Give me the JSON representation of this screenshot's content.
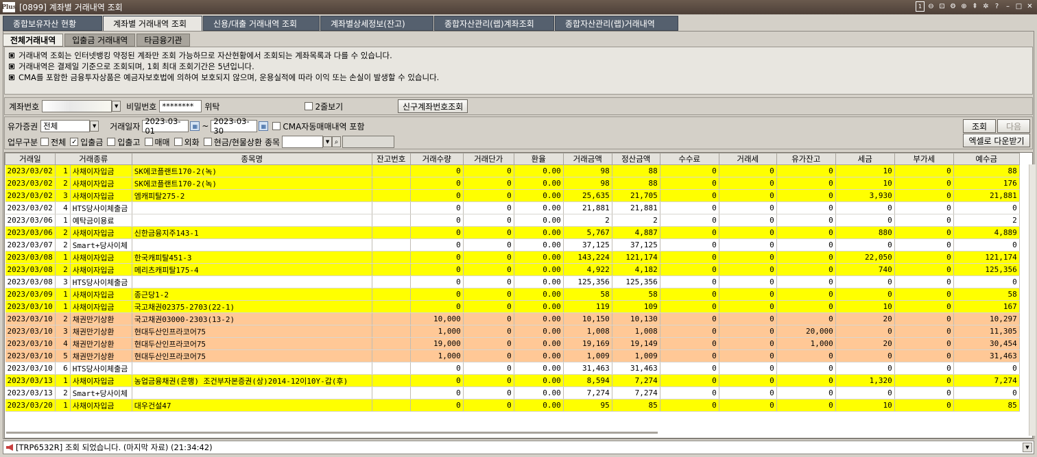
{
  "window": {
    "title": "[0899] 계좌별 거래내역 조회",
    "logo": "Plus",
    "page_indicator": "1"
  },
  "main_tabs": [
    {
      "label": "종합보유자산 현황",
      "active": false
    },
    {
      "label": "계좌별 거래내역 조회",
      "active": true
    },
    {
      "label": "신용/대출 거래내역 조회",
      "active": false
    },
    {
      "label": "계좌별상세정보(잔고)",
      "active": false
    },
    {
      "label": "종합자산관리(랩)계좌조회",
      "active": false
    },
    {
      "label": "종합자산관리(랩)거래내역",
      "active": false
    }
  ],
  "sub_tabs": [
    {
      "label": "전체거래내역",
      "active": true
    },
    {
      "label": "입출금 거래내역",
      "active": false
    },
    {
      "label": "타금융기관",
      "active": false
    }
  ],
  "notices": [
    "거래내역 조회는 인터넷뱅킹 약정된 계좌만 조회 가능하므로 자산현황에서 조회되는 계좌목록과 다를 수 있습니다.",
    "거래내역은 결제일 기준으로 조회되며, 1회 최대 조회기간은 5년입니다.",
    "CMA를 포함한 금융투자상품은 예금자보호법에 의하여 보호되지 않으며, 운용실적에 따라 이익 또는 손실이 발생할 수 있습니다."
  ],
  "account": {
    "label": "계좌번호",
    "password_label": "비밀번호",
    "password_value": "********",
    "trust_label": "위탁",
    "two_line_label": "2줄보기",
    "old_new_button": "신구계좌번호조회"
  },
  "filter": {
    "securities_label": "유가증권",
    "securities_value": "전체",
    "date_label": "거래일자",
    "date_from": "2023-03-01",
    "date_sep": "~",
    "date_to": "2023-03-30",
    "cma_label": "CMA자동매매내역 포함",
    "biz_label": "업무구분",
    "checks": [
      {
        "label": "전체",
        "checked": false
      },
      {
        "label": "입출금",
        "checked": true
      },
      {
        "label": "입출고",
        "checked": false
      },
      {
        "label": "매매",
        "checked": false
      },
      {
        "label": "외화",
        "checked": false
      },
      {
        "label": "현금/현물상환",
        "checked": false
      }
    ],
    "item_label": "종목",
    "query_button": "조회",
    "next_button": "다음",
    "excel_button": "엑셀로 다운받기"
  },
  "table": {
    "columns": [
      "거래일",
      "거래종류",
      "종목명",
      "잔고번호",
      "거래수량",
      "거래단가",
      "환율",
      "거래금액",
      "정산금액",
      "수수료",
      "거래세",
      "유가잔고",
      "세금",
      "부가세",
      "예수금"
    ],
    "rows": [
      {
        "style": "yellow",
        "cells": [
          "2023/03/02",
          "1",
          "사채이자입금",
          "SK에코플랜트170-2(녹)",
          "",
          "0",
          "0",
          "0.00",
          "98",
          "88",
          "0",
          "0",
          "0",
          "10",
          "0",
          "88"
        ]
      },
      {
        "style": "yellow",
        "cells": [
          "2023/03/02",
          "2",
          "사채이자입금",
          "SK에코플랜트170-2(녹)",
          "",
          "0",
          "0",
          "0.00",
          "98",
          "88",
          "0",
          "0",
          "0",
          "10",
          "0",
          "176"
        ]
      },
      {
        "style": "yellow",
        "cells": [
          "2023/03/02",
          "3",
          "사채이자입금",
          "엠캐피탈275-2",
          "",
          "0",
          "0",
          "0.00",
          "25,635",
          "21,705",
          "0",
          "0",
          "0",
          "3,930",
          "0",
          "21,881"
        ]
      },
      {
        "style": "white",
        "cells": [
          "2023/03/02",
          "4",
          "HTS당사이체출금",
          "",
          "",
          "0",
          "0",
          "0.00",
          "21,881",
          "21,881",
          "0",
          "0",
          "0",
          "0",
          "0",
          "0"
        ]
      },
      {
        "style": "white",
        "cells": [
          "2023/03/06",
          "1",
          "예탁금이용료",
          "",
          "",
          "0",
          "0",
          "0.00",
          "2",
          "2",
          "0",
          "0",
          "0",
          "0",
          "0",
          "2"
        ]
      },
      {
        "style": "yellow",
        "cells": [
          "2023/03/06",
          "2",
          "사채이자입금",
          "신한금융지주143-1",
          "",
          "0",
          "0",
          "0.00",
          "5,767",
          "4,887",
          "0",
          "0",
          "0",
          "880",
          "0",
          "4,889"
        ]
      },
      {
        "style": "white",
        "cells": [
          "2023/03/07",
          "2",
          "Smart+당사이체",
          "",
          "",
          "0",
          "0",
          "0.00",
          "37,125",
          "37,125",
          "0",
          "0",
          "0",
          "0",
          "0",
          "0"
        ]
      },
      {
        "style": "yellow",
        "cells": [
          "2023/03/08",
          "1",
          "사채이자입금",
          "한국캐피탈451-3",
          "",
          "0",
          "0",
          "0.00",
          "143,224",
          "121,174",
          "0",
          "0",
          "0",
          "22,050",
          "0",
          "121,174"
        ]
      },
      {
        "style": "yellow",
        "cells": [
          "2023/03/08",
          "2",
          "사채이자입금",
          "메리츠캐피탈175-4",
          "",
          "0",
          "0",
          "0.00",
          "4,922",
          "4,182",
          "0",
          "0",
          "0",
          "740",
          "0",
          "125,356"
        ]
      },
      {
        "style": "white",
        "cells": [
          "2023/03/08",
          "3",
          "HTS당사이체출금",
          "",
          "",
          "0",
          "0",
          "0.00",
          "125,356",
          "125,356",
          "0",
          "0",
          "0",
          "0",
          "0",
          "0"
        ]
      },
      {
        "style": "yellow",
        "cells": [
          "2023/03/09",
          "1",
          "사채이자입금",
          "종근당1-2",
          "",
          "0",
          "0",
          "0.00",
          "58",
          "58",
          "0",
          "0",
          "0",
          "0",
          "0",
          "58"
        ]
      },
      {
        "style": "yellow",
        "cells": [
          "2023/03/10",
          "1",
          "사채이자입금",
          "국고채권02375-2703(22-1)",
          "",
          "0",
          "0",
          "0.00",
          "119",
          "109",
          "0",
          "0",
          "0",
          "10",
          "0",
          "167"
        ]
      },
      {
        "style": "orange",
        "cells": [
          "2023/03/10",
          "2",
          "채권만기상환",
          "국고채권03000-2303(13-2)",
          "",
          "10,000",
          "0",
          "0.00",
          "10,150",
          "10,130",
          "0",
          "0",
          "0",
          "20",
          "0",
          "10,297"
        ]
      },
      {
        "style": "orange",
        "cells": [
          "2023/03/10",
          "3",
          "채권만기상환",
          "현대두산인프라코어75",
          "",
          "1,000",
          "0",
          "0.00",
          "1,008",
          "1,008",
          "0",
          "0",
          "20,000",
          "0",
          "0",
          "11,305"
        ]
      },
      {
        "style": "orange",
        "cells": [
          "2023/03/10",
          "4",
          "채권만기상환",
          "현대두산인프라코어75",
          "",
          "19,000",
          "0",
          "0.00",
          "19,169",
          "19,149",
          "0",
          "0",
          "1,000",
          "20",
          "0",
          "30,454"
        ]
      },
      {
        "style": "orange",
        "cells": [
          "2023/03/10",
          "5",
          "채권만기상환",
          "현대두산인프라코어75",
          "",
          "1,000",
          "0",
          "0.00",
          "1,009",
          "1,009",
          "0",
          "0",
          "0",
          "0",
          "0",
          "31,463"
        ]
      },
      {
        "style": "white",
        "cells": [
          "2023/03/10",
          "6",
          "HTS당사이체출금",
          "",
          "",
          "0",
          "0",
          "0.00",
          "31,463",
          "31,463",
          "0",
          "0",
          "0",
          "0",
          "0",
          "0"
        ]
      },
      {
        "style": "yellow",
        "cells": [
          "2023/03/13",
          "1",
          "사채이자입금",
          "농업금융채권(은행) 조건부자본증권(상)2014-12이10Y-갑(후)",
          "",
          "0",
          "0",
          "0.00",
          "8,594",
          "7,274",
          "0",
          "0",
          "0",
          "1,320",
          "0",
          "7,274"
        ]
      },
      {
        "style": "white",
        "cells": [
          "2023/03/13",
          "2",
          "Smart+당사이체",
          "",
          "",
          "0",
          "0",
          "0.00",
          "7,274",
          "7,274",
          "0",
          "0",
          "0",
          "0",
          "0",
          "0"
        ]
      },
      {
        "style": "yellow",
        "cells": [
          "2023/03/20",
          "1",
          "사채이자입금",
          "대우건설47",
          "",
          "0",
          "0",
          "0.00",
          "95",
          "85",
          "0",
          "0",
          "0",
          "10",
          "0",
          "85"
        ]
      }
    ]
  },
  "status": {
    "message": "[TRP6532R] 조회 되었습니다. (마지막 자료) (21:34:42)"
  }
}
